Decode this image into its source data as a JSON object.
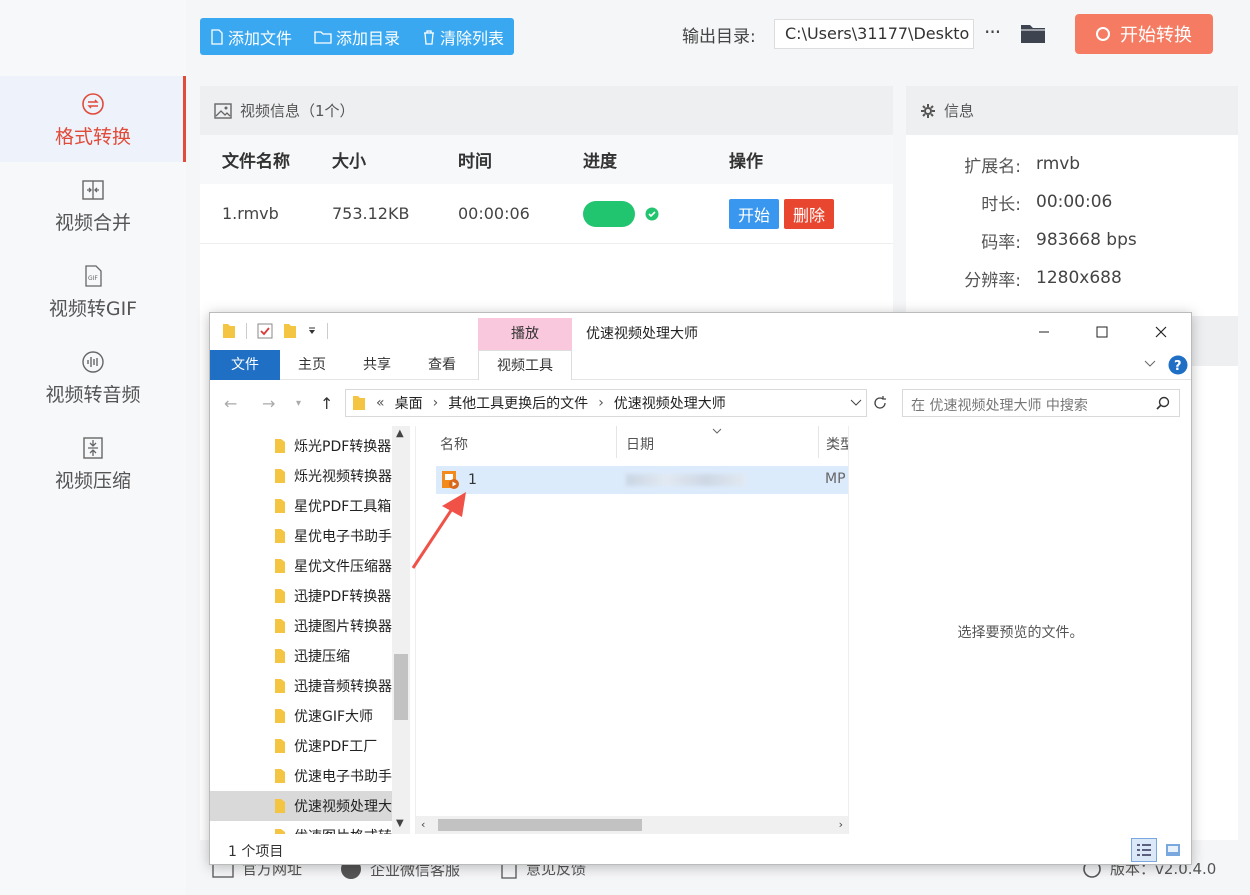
{
  "toolbar": {
    "add_file": "添加文件",
    "add_dir": "添加目录",
    "clear_list": "清除列表",
    "output_label": "输出目录:",
    "output_path": "C:\\Users\\31177\\Deskto",
    "more": "···",
    "start_convert": "开始转换"
  },
  "sidebar": {
    "items": [
      {
        "label": "格式转换",
        "icon": "convert-icon"
      },
      {
        "label": "视频合并",
        "icon": "merge-icon"
      },
      {
        "label": "视频转GIF",
        "icon": "gif-icon"
      },
      {
        "label": "视频转音频",
        "icon": "audio-icon"
      },
      {
        "label": "视频压缩",
        "icon": "compress-icon"
      }
    ]
  },
  "video_panel": {
    "title": "视频信息（1个）",
    "columns": [
      "文件名称",
      "大小",
      "时间",
      "进度",
      "操作"
    ],
    "rows": [
      {
        "name": "1.rmvb",
        "size": "753.12KB",
        "time": "00:00:06",
        "progress": 1.0,
        "start": "开始",
        "delete": "删除"
      }
    ]
  },
  "info_panel": {
    "title": "信息",
    "fields": [
      {
        "k": "扩展名:",
        "v": "rmvb"
      },
      {
        "k": "时长:",
        "v": "00:00:06"
      },
      {
        "k": "码率:",
        "v": "983668 bps"
      },
      {
        "k": "分辨率:",
        "v": "1280x688"
      }
    ]
  },
  "footer": {
    "site": "官方网址",
    "wechat": "企业微信客服",
    "feedback": "意见反馈",
    "version": "版本：v2.0.4.0"
  },
  "explorer": {
    "context_tab": "播放",
    "title": "优速视频处理大师",
    "ribbon_tabs": [
      "文件",
      "主页",
      "共享",
      "查看",
      "视频工具"
    ],
    "breadcrumb": [
      "桌面",
      "其他工具更换后的文件",
      "优速视频处理大师"
    ],
    "search_placeholder": "在 优速视频处理大师 中搜索",
    "nav_items": [
      "烁光PDF转换器",
      "烁光视频转换器",
      "星优PDF工具箱",
      "星优电子书助手",
      "星优文件压缩器",
      "迅捷PDF转换器",
      "迅捷图片转换器",
      "迅捷压缩",
      "迅捷音频转换器",
      "优速GIF大师",
      "优速PDF工厂",
      "优速电子书助手",
      "优速视频处理大师",
      "优速图片格式转换器"
    ],
    "selected_nav": "优速视频处理大师",
    "columns": [
      "名称",
      "日期",
      "类型"
    ],
    "file": {
      "name": "1",
      "type": "MP"
    },
    "preview_text": "选择要预览的文件。",
    "status": "1 个项目"
  },
  "colors": {
    "accent_red": "#e04b3a",
    "toolbar_blue": "#3aa8f0",
    "start_orange": "#f57c63",
    "progress_green": "#21c46f"
  }
}
